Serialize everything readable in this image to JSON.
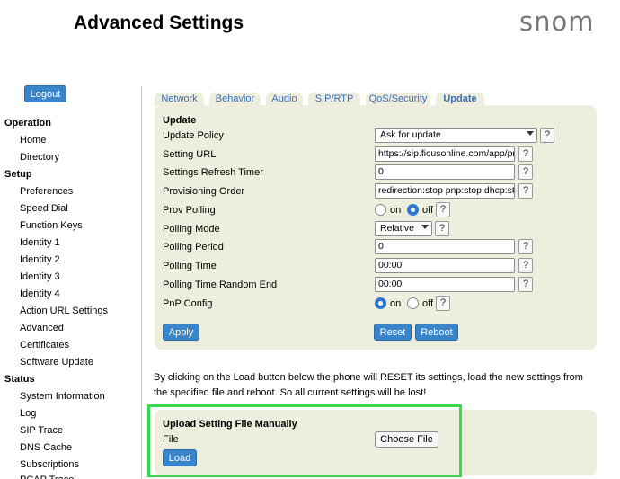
{
  "header": {
    "title": "Advanced Settings",
    "logo_text": "snom"
  },
  "sidebar": {
    "logout_label": "Logout",
    "sections": [
      {
        "heading": "Operation",
        "items": [
          "Home",
          "Directory"
        ]
      },
      {
        "heading": "Setup",
        "items": [
          "Preferences",
          "Speed Dial",
          "Function Keys",
          "Identity 1",
          "Identity 2",
          "Identity 3",
          "Identity 4",
          "Action URL Settings",
          "Advanced",
          "Certificates",
          "Software Update"
        ]
      },
      {
        "heading": "Status",
        "items": [
          "System Information",
          "Log",
          "SIP Trace",
          "DNS Cache",
          "Subscriptions",
          "PCAP Trace"
        ]
      }
    ]
  },
  "tabs": [
    {
      "label": "Network",
      "active": false
    },
    {
      "label": "Behavior",
      "active": false
    },
    {
      "label": "Audio",
      "active": false
    },
    {
      "label": "SIP/RTP",
      "active": false
    },
    {
      "label": "QoS/Security",
      "active": false
    },
    {
      "label": "Update",
      "active": true
    }
  ],
  "update": {
    "section_title": "Update",
    "help_label": "?",
    "on_label": "on",
    "off_label": "off",
    "rows": {
      "update_policy": {
        "label": "Update Policy",
        "value": "Ask for update"
      },
      "setting_url": {
        "label": "Setting URL",
        "value": "https://sip.ficusonline.com/app/pr"
      },
      "settings_refresh_timer": {
        "label": "Settings Refresh Timer",
        "value": "0"
      },
      "provisioning_order": {
        "label": "Provisioning Order",
        "value": "redirection:stop pnp:stop dhcp:st"
      },
      "prov_polling": {
        "label": "Prov Polling",
        "selected": "off"
      },
      "polling_mode": {
        "label": "Polling Mode",
        "value": "Relative"
      },
      "polling_period": {
        "label": "Polling Period",
        "value": "0"
      },
      "polling_time": {
        "label": "Polling Time",
        "value": "00:00"
      },
      "polling_time_random_end": {
        "label": "Polling Time Random End",
        "value": "00:00"
      },
      "pnp_config": {
        "label": "PnP Config",
        "selected": "on"
      }
    },
    "apply_label": "Apply",
    "reset_label": "Reset",
    "reboot_label": "Reboot"
  },
  "warning_text": "By clicking on the Load button below the phone will RESET its settings, load the new settings from the specified file and reboot. So all current settings will be lost!",
  "upload": {
    "title": "Upload Setting File Manually",
    "file_label": "File",
    "choose_label": "Choose File",
    "load_label": "Load"
  },
  "colors": {
    "accent": "#3a84c9",
    "panel": "#eeeedf",
    "highlight": "#35d94a",
    "tab_text": "#3b6fb6"
  }
}
